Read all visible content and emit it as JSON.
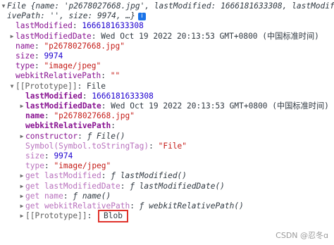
{
  "header": {
    "line1": "File {name: 'p2678027668.jpg', lastModified: 1666181633308, lastModifi",
    "line2": "ivePath: '', size: 9974, …}",
    "info": "i"
  },
  "props": [
    {
      "key": "lastModified",
      "sep": ": ",
      "val": "1666181633308",
      "vclass": "num"
    },
    {
      "key": "lastModifiedDate",
      "sep": ": ",
      "val": "Wed Oct 19 2022 20:13:53 GMT+0800 (中国标准时间)",
      "vclass": "plain"
    },
    {
      "key": "name",
      "sep": ": ",
      "val": "\"p2678027668.jpg\"",
      "vclass": "str"
    },
    {
      "key": "size",
      "sep": ": ",
      "val": "9974",
      "vclass": "num"
    },
    {
      "key": "type",
      "sep": ": ",
      "val": "\"image/jpeg\"",
      "vclass": "str"
    },
    {
      "key": "webkitRelativePath",
      "sep": ": ",
      "val": "\"\"",
      "vclass": "str"
    }
  ],
  "proto": {
    "label": "[[Prototype]]",
    "sep": ": ",
    "value": "File"
  },
  "proto_props": [
    {
      "key": "lastModified",
      "sep": ": ",
      "val": "1666181633308"
    },
    {
      "key": "lastModifiedDate",
      "sep": ": ",
      "val": "Wed Oct 19 2022 20:13:53 GMT+0800 (中国标准时间)"
    },
    {
      "key": "name",
      "sep": ": ",
      "val": "\"p2678027668.jpg\""
    },
    {
      "key": "webkitRelativePath",
      "sep": ": ",
      "val": ""
    },
    {
      "key": "constructor",
      "sep": ": ",
      "val": "ƒ File()"
    },
    {
      "key": "Symbol(Symbol.toStringTag)",
      "sep": ": ",
      "val": "\"File\""
    },
    {
      "key": "size",
      "sep": ": ",
      "val": "9974"
    },
    {
      "key": "type",
      "sep": ": ",
      "val": "\"image/jpeg\""
    },
    {
      "key": "get lastModified",
      "sep": ": ",
      "val": "ƒ lastModified()"
    },
    {
      "key": "get lastModifiedDate",
      "sep": ": ",
      "val": "ƒ lastModifiedDate()"
    },
    {
      "key": "get name",
      "sep": ": ",
      "val": "ƒ name()"
    },
    {
      "key": "get webkitRelativePath",
      "sep": ": ",
      "val": "ƒ webkitRelativePath()"
    }
  ],
  "proto2": {
    "label": "[[Prototype]]",
    "sep": ": ",
    "value": "Blob"
  },
  "watermark": "CSDN @忍冬ɑ"
}
